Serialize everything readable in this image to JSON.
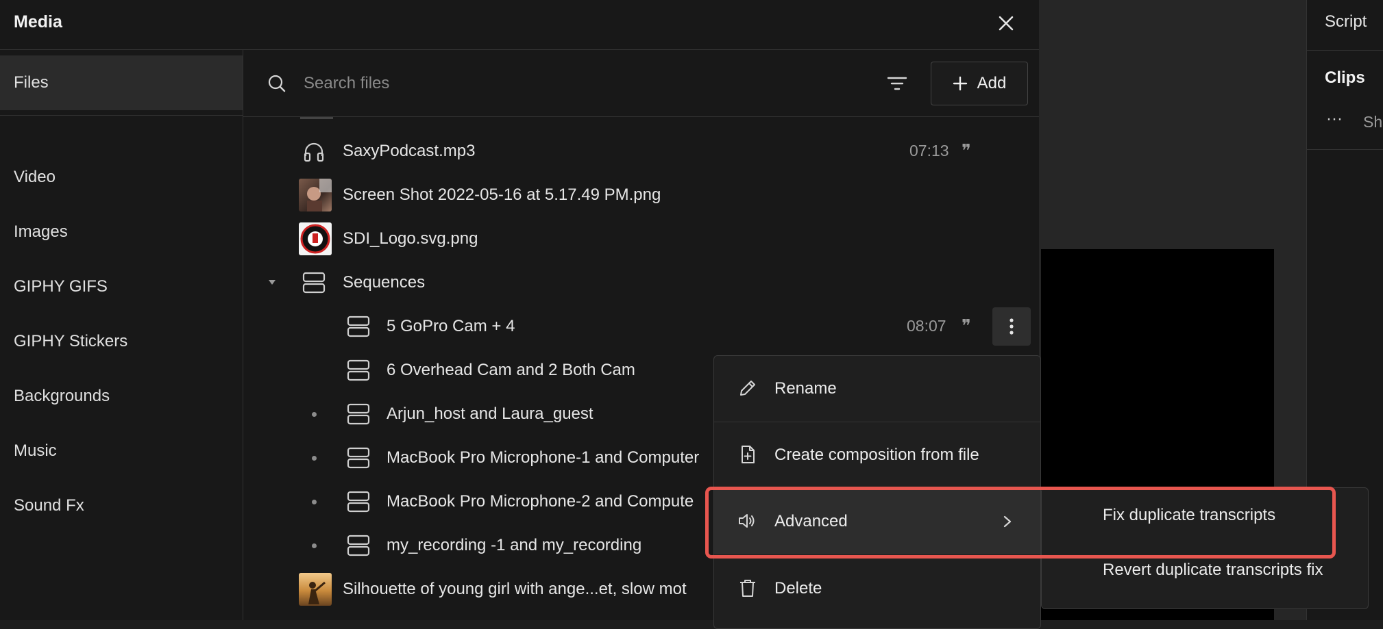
{
  "media": {
    "title": "Media",
    "close_icon": "close-icon"
  },
  "sidebar": {
    "items": [
      {
        "label": "Files",
        "active": true
      },
      {
        "label": "Video"
      },
      {
        "label": "Images"
      },
      {
        "label": "GIPHY GIFS"
      },
      {
        "label": "GIPHY Stickers"
      },
      {
        "label": "Backgrounds"
      },
      {
        "label": "Music"
      },
      {
        "label": "Sound Fx"
      }
    ]
  },
  "toolbar": {
    "search_placeholder": "Search files",
    "search_icon": "search-icon",
    "filter_icon": "filter-icon",
    "add_label": "Add"
  },
  "files": [
    {
      "name": "SaxyPodcast.mp3",
      "duration": "07:13",
      "icon": "headphones-icon",
      "has_transcript": true
    },
    {
      "name": "Screen Shot 2022-05-16 at 5.17.49 PM.png",
      "icon": "image-thumbnail"
    },
    {
      "name": "SDI_Logo.svg.png",
      "icon": "logo-thumbnail"
    },
    {
      "name": "Sequences",
      "icon": "sequence-folder-icon",
      "expanded": true
    },
    {
      "name": "5 GoPro Cam + 4",
      "duration": "08:07",
      "icon": "sequence-icon",
      "has_transcript": true
    },
    {
      "name": "6 Overhead Cam and 2 Both Cam",
      "icon": "sequence-icon"
    },
    {
      "name": "Arjun_host and Laura_guest",
      "icon": "sequence-icon"
    },
    {
      "name": "MacBook Pro Microphone-1 and Computer",
      "icon": "sequence-icon"
    },
    {
      "name": "MacBook Pro Microphone-2 and Compute",
      "icon": "sequence-icon"
    },
    {
      "name": "my_recording -1 and my_recording",
      "icon": "sequence-icon"
    },
    {
      "name": "Silhouette of young girl with ange...et, slow mot",
      "icon": "video-thumbnail"
    }
  ],
  "context_menu": {
    "items": [
      {
        "label": "Rename",
        "icon": "pencil-icon"
      },
      {
        "label": "Create composition from file",
        "icon": "file-plus-icon"
      },
      {
        "label": "Advanced",
        "icon": "speaker-icon",
        "has_submenu": true
      },
      {
        "label": "Delete",
        "icon": "trash-icon"
      }
    ]
  },
  "submenu": {
    "items": [
      {
        "label": "Fix duplicate transcripts"
      },
      {
        "label": "Revert duplicate transcripts fix"
      }
    ]
  },
  "right_panel": {
    "script_label": "Script",
    "clips_label": "Clips",
    "more_label": "···",
    "truncated_label": "Sh"
  },
  "colors": {
    "background": "#181818",
    "highlight": "#e8564f",
    "menu_hover": "#2d2d2d"
  }
}
